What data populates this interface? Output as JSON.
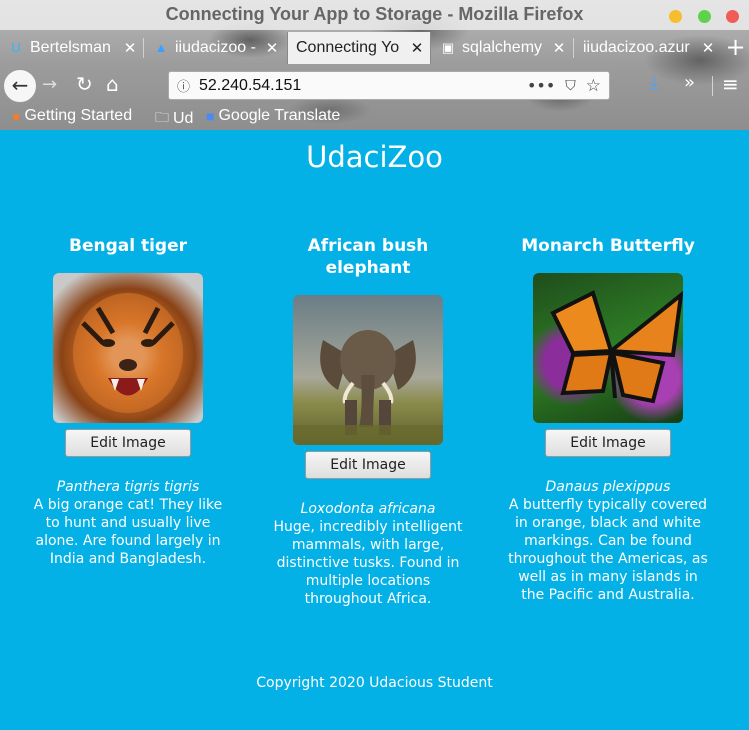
{
  "browser": {
    "window_title": "Connecting Your App to Storage - Mozilla Firefox",
    "tabs": [
      {
        "label": "Bertelsman",
        "icon": "udacity-icon",
        "active": false
      },
      {
        "label": "iiudacizoo -",
        "icon": "azure-icon",
        "active": false
      },
      {
        "label": "Connecting Yo",
        "icon": "",
        "active": true
      },
      {
        "label": "sqlalchemy",
        "icon": "terminal-icon",
        "active": false
      },
      {
        "label": "iiudacizoo.azur",
        "icon": "",
        "active": false
      }
    ],
    "url": "52.240.54.151",
    "bookmarks": [
      {
        "label": "Getting Started",
        "icon": "firefox-icon"
      },
      {
        "label": "Ud",
        "icon": "folder-icon"
      },
      {
        "label": "Google Translate",
        "icon": "translate-icon"
      }
    ]
  },
  "page": {
    "title": "UdaciZoo",
    "animals": [
      {
        "name": "Bengal tiger",
        "scientific_name": "Panthera tigris tigris",
        "description": "A big orange cat! They like to hunt and usually live alone. Are found largely in India and Bangladesh.",
        "image_alt": "Bengal tiger photo",
        "edit_label": "Edit Image"
      },
      {
        "name": "African bush elephant",
        "scientific_name": "Loxodonta africana",
        "description": "Huge, incredibly intelligent mammals, with large, distinctive tusks. Found in multiple locations throughout Africa.",
        "image_alt": "African bush elephant photo",
        "edit_label": "Edit Image"
      },
      {
        "name": "Monarch Butterfly",
        "scientific_name": "Danaus plexippus",
        "description": "A butterfly typically covered in orange, black and white markings. Can be found throughout the Americas, as well as in many islands in the Pacific and Australia.",
        "image_alt": "Monarch butterfly photo",
        "edit_label": "Edit Image"
      }
    ],
    "footer": "Copyright 2020 Udacious Student"
  },
  "colors": {
    "page_background": "#03b1e6",
    "text": "#ffffff"
  }
}
